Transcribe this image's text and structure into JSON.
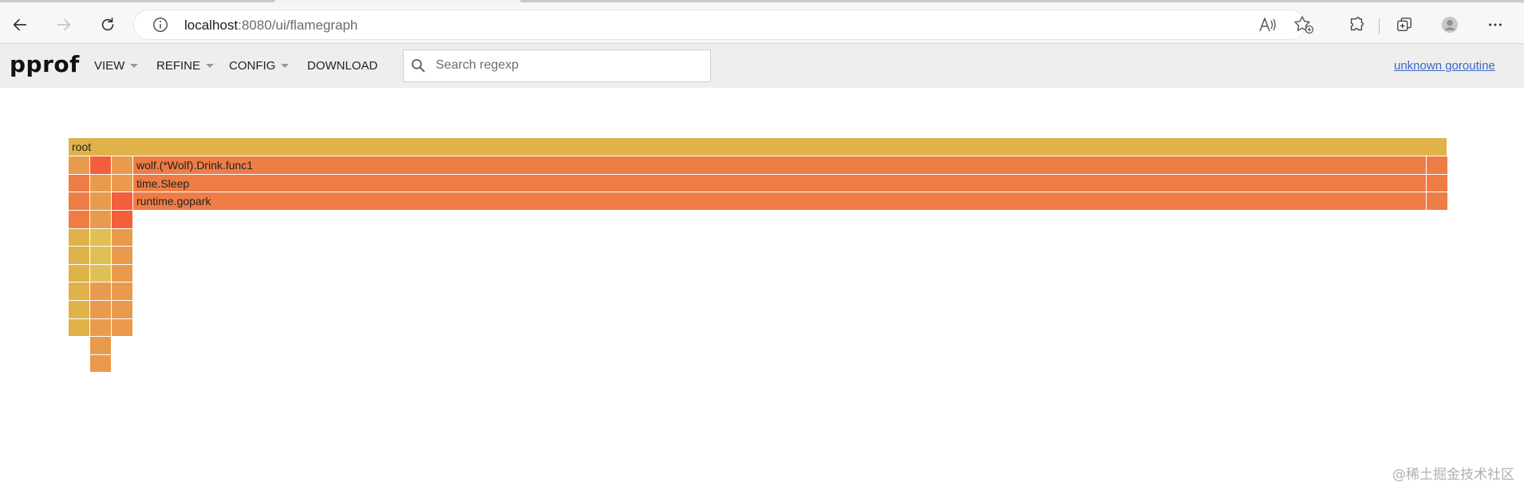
{
  "browser": {
    "url_host": "localhost",
    "url_path": ":8080/ui/flamegraph"
  },
  "header": {
    "logo": "pprof",
    "menu": [
      {
        "label": "VIEW",
        "has_dropdown": true
      },
      {
        "label": "REFINE",
        "has_dropdown": true
      },
      {
        "label": "CONFIG",
        "has_dropdown": true
      },
      {
        "label": "DOWNLOAD",
        "has_dropdown": false
      }
    ],
    "search_placeholder": "Search regexp",
    "search_value": "",
    "profile_link": "unknown goroutine"
  },
  "flamegraph": {
    "root_label": "root",
    "main_stack": [
      "wolf.(*Wolf).Drink.func1",
      "time.Sleep",
      "runtime.gopark"
    ],
    "colors": {
      "root": "#e0b24a",
      "hot": "#f25f3a",
      "orange": "#ee7d45",
      "amber": "#ea9a4c",
      "yellow": "#e0c055",
      "mustard": "#e0b24a"
    }
  },
  "watermark": "@稀土掘金技术社区"
}
